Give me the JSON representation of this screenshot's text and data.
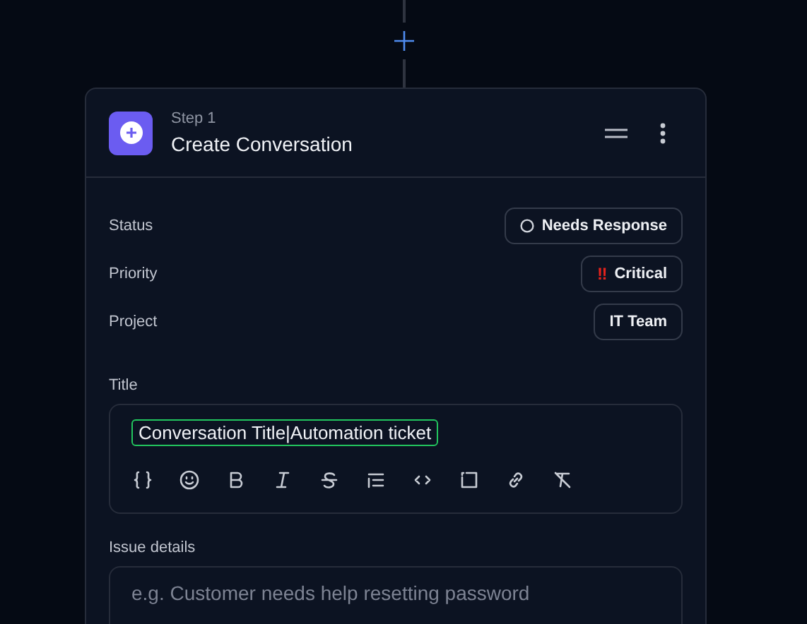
{
  "step": {
    "label": "Step 1",
    "title": "Create Conversation"
  },
  "properties": [
    {
      "label": "Status",
      "value": "Needs Response",
      "kind": "status"
    },
    {
      "label": "Priority",
      "value": "Critical",
      "kind": "priority",
      "mark": "‼"
    },
    {
      "label": "Project",
      "value": "IT Team",
      "kind": "plain"
    }
  ],
  "title_field": {
    "label": "Title",
    "value": "Conversation Title|Automation ticket"
  },
  "details_field": {
    "label": "Issue details",
    "placeholder": "e.g. Customer needs help resetting password"
  }
}
